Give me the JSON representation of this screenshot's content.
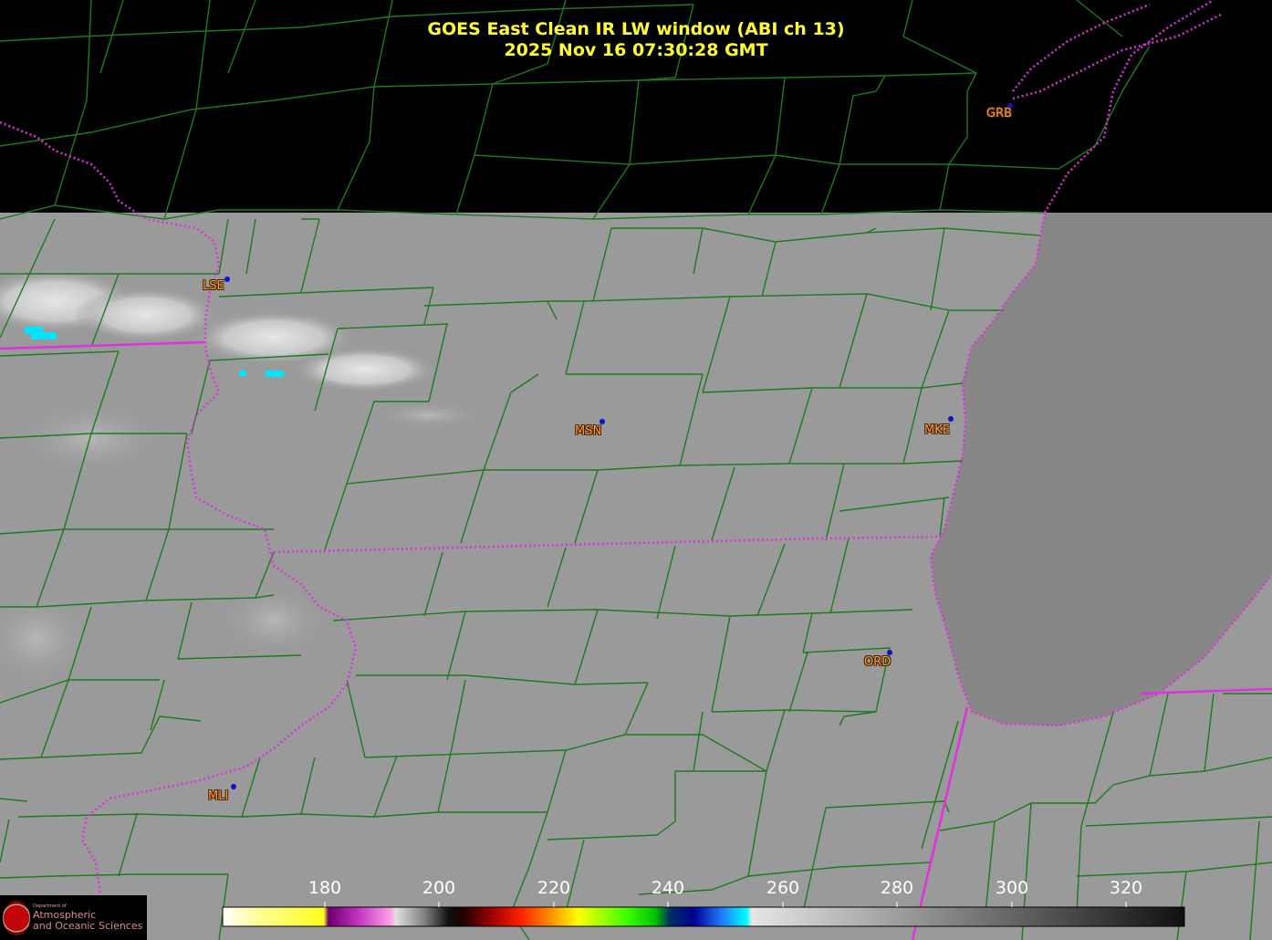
{
  "header": {
    "title": "GOES East Clean IR LW window (ABI ch 13)",
    "timestamp": "2025 Nov 16  07:30:28 GMT"
  },
  "stations": [
    {
      "code": "GRB"
    },
    {
      "code": "LSE"
    },
    {
      "code": "MSN"
    },
    {
      "code": "MKE"
    },
    {
      "code": "ORD"
    },
    {
      "code": "MLI"
    }
  ],
  "colorbar": {
    "ticks": [
      "180",
      "200",
      "220",
      "240",
      "260",
      "280",
      "300",
      "320"
    ]
  },
  "logo": {
    "dept": "Department of",
    "line1": "Atmospheric",
    "line2": "and Oceanic Sciences"
  },
  "colors": {
    "county_lines": "#1e7a1e",
    "state_lines": "#e030e0",
    "title": "#ffff33",
    "station_label": "#ff9a3c",
    "no_data": "#000000",
    "land_ir": "#9a9a9a",
    "lake_ir": "#878787",
    "cold_cloud": "#00e5ff"
  }
}
